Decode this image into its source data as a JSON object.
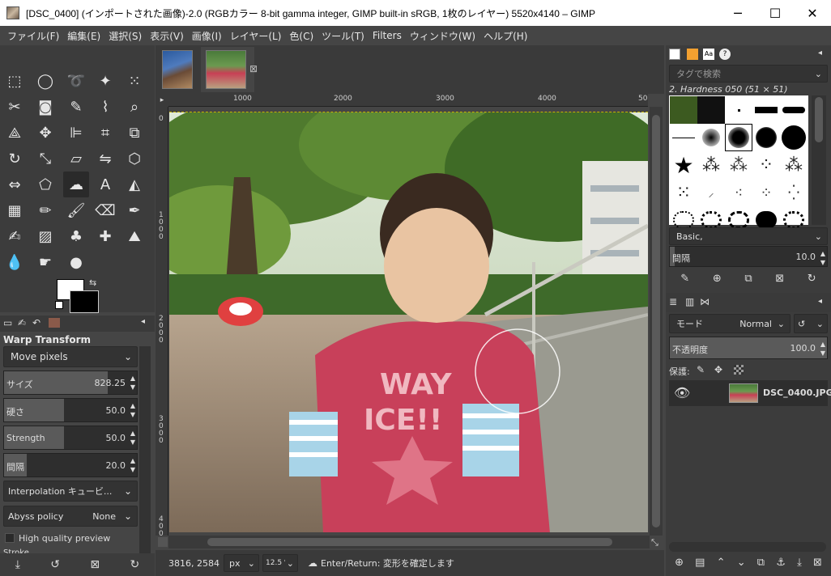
{
  "window": {
    "title": "[DSC_0400] (インポートされた画像)-2.0 (RGBカラー 8-bit gamma integer, GIMP built-in sRGB, 1枚のレイヤー) 5520x4140 – GIMP",
    "minimize": "─",
    "maximize": "☐",
    "close": "✕"
  },
  "menu": [
    "ファイル(F)",
    "編集(E)",
    "選択(S)",
    "表示(V)",
    "画像(I)",
    "レイヤー(L)",
    "色(C)",
    "ツール(T)",
    "Filters",
    "ウィンドウ(W)",
    "ヘルプ(H)"
  ],
  "tool_options": {
    "title": "Warp Transform",
    "mode": "Move pixels",
    "size_label": "サイズ",
    "size_value": "828.25",
    "size_level": 0.78,
    "hardness_label": "硬さ",
    "hardness_value": "50.0",
    "hardness_level": 0.45,
    "strength_label": "Strength",
    "strength_value": "50.0",
    "strength_level": 0.45,
    "spacing_label": "間隔",
    "spacing_value": "20.0",
    "spacing_level": 0.17,
    "interpolation": "Interpolation キュービ...",
    "abyss_label": "Abyss policy",
    "abyss_value": "None",
    "hq_preview": "High quality preview",
    "stroke_label": "Stroke"
  },
  "rulers": {
    "h": [
      "1000",
      "2000",
      "3000",
      "4000",
      "50"
    ],
    "v": [
      "0",
      "1000",
      "2000",
      "3000",
      "4000"
    ]
  },
  "status": {
    "coords": "3816, 2584",
    "unit": "px",
    "zoom": "12.5 %",
    "message": "Enter/Return: 変形を確定します"
  },
  "brushes": {
    "search_placeholder": "タグで検索",
    "selected": "2. Hardness 050 (51 × 51)",
    "preset": "Basic,",
    "spacing_label": "間隔",
    "spacing_value": "10.0"
  },
  "layers": {
    "mode_label": "モード",
    "mode_value": "Normal",
    "opacity_label": "不透明度",
    "opacity_value": "100.0",
    "lock_label": "保護:",
    "layer_name": "DSC_0400.JPG"
  },
  "colors": {
    "fg": "#ffffff",
    "bg": "#000000",
    "selection": "#c8b400"
  }
}
